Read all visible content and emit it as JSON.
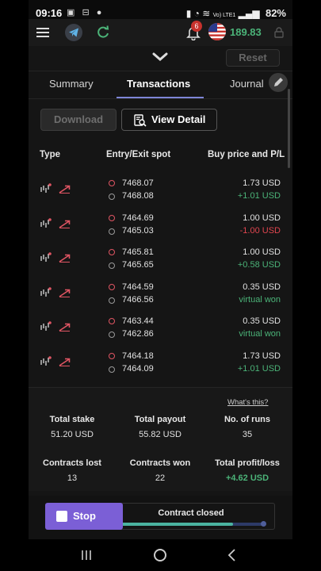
{
  "status_bar": {
    "time": "09:16",
    "network": "Vo) LTE1",
    "battery": "82%"
  },
  "header": {
    "notification_count": "6",
    "balance": "189.83",
    "balance_color": "#4bb378"
  },
  "controls": {
    "reset_label": "Reset"
  },
  "tabs": [
    {
      "label": "Summary",
      "active": false
    },
    {
      "label": "Transactions",
      "active": true
    },
    {
      "label": "Journal",
      "active": false
    }
  ],
  "actions": {
    "download_label": "Download",
    "view_detail_label": "View Detail"
  },
  "table": {
    "headers": [
      "Type",
      "Entry/Exit spot",
      "Buy price and P/L"
    ],
    "rows": [
      {
        "entry": "7468.07",
        "exit": "7468.08",
        "buy": "1.73 USD",
        "pl": "+1.01 USD",
        "pl_type": "pos"
      },
      {
        "entry": "7464.69",
        "exit": "7465.03",
        "buy": "1.00 USD",
        "pl": "-1.00 USD",
        "pl_type": "neg"
      },
      {
        "entry": "7465.81",
        "exit": "7465.65",
        "buy": "1.00 USD",
        "pl": "+0.58 USD",
        "pl_type": "pos"
      },
      {
        "entry": "7464.59",
        "exit": "7466.56",
        "buy": "0.35 USD",
        "pl": "virtual won",
        "pl_type": "pos"
      },
      {
        "entry": "7463.44",
        "exit": "7462.86",
        "buy": "0.35 USD",
        "pl": "virtual won",
        "pl_type": "pos"
      },
      {
        "entry": "7464.18",
        "exit": "7464.09",
        "buy": "1.73 USD",
        "pl": "+1.01 USD",
        "pl_type": "pos"
      }
    ]
  },
  "summary": {
    "whats_this": "What's this?",
    "total_stake_label": "Total stake",
    "total_stake": "51.20 USD",
    "total_payout_label": "Total payout",
    "total_payout": "55.82 USD",
    "runs_label": "No. of runs",
    "runs": "35",
    "lost_label": "Contracts lost",
    "lost": "13",
    "won_label": "Contracts won",
    "won": "22",
    "profit_label": "Total profit/loss",
    "profit": "+4.62 USD"
  },
  "run_panel": {
    "stop_label": "Stop",
    "status_label": "Contract closed",
    "progress": 0.78,
    "accent": "#7b5fd6"
  }
}
